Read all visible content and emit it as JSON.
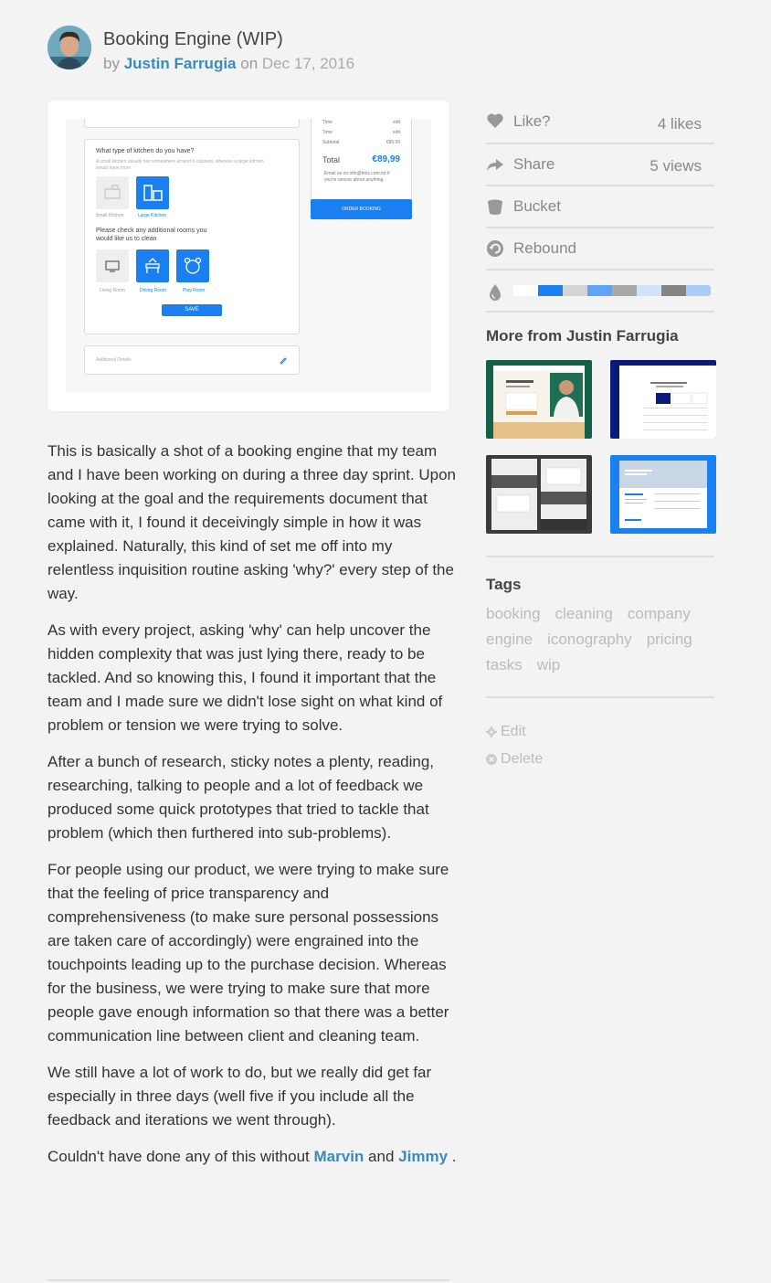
{
  "shot": {
    "title": "Booking Engine (WIP)",
    "by": "by",
    "author": "Justin Farrugia",
    "on": "on",
    "date": "Dec 17, 2016"
  },
  "preview": {
    "time1": "Time",
    "edit1": "edit",
    "time2": "Time",
    "edit2": "edit",
    "subtotal": "Subtotal",
    "subtotal_value": "€89.99",
    "total": "Total",
    "total_value": "€89,99",
    "email_line1": "Email us on info@briiz.com.mt if",
    "email_line2": "you're unsure about anything.",
    "order_button": "ORDER BOOKING",
    "kitchen_question": "What type of kitchen do you have?",
    "kitchen_hint1": "A small kitchen usually has somewhere around 6 cabinets, whereas a large kitchen",
    "kitchen_hint2": "would have more",
    "small_kitchen": "Small Kitchen",
    "large_kitchen": "Large Kitchen",
    "rooms_question1": "Please check any additional rooms you",
    "rooms_question2": "would like us to clean",
    "living_room": "Living Room",
    "dining_room": "Dining Room",
    "play_room": "Play Room",
    "save_button": "SAVE",
    "additional_details": "Additional Details"
  },
  "description": {
    "p1": "This is basically a shot of a booking engine that my team and I have been working on during a three day sprint. Upon looking at the goal and the requirements document that came with it, I found it deceivingly simple in how it was explained. Naturally, this kind of set me off into my relentless inquisition routine asking 'why?' every step of the way.",
    "p2": "As with every project, asking 'why' can help uncover the hidden complexity that was just lying there, ready to be tackled. And so knowing this, I found it important that the team and I made sure we didn't lose sight on what kind of problem or tension we were trying to solve.",
    "p3": "After a bunch of research, sticky notes a plenty, reading, researching, talking to people and a lot of feedback we produced some quick prototypes that tried to tackle that problem (which then furthered into sub-problems).",
    "p4": "For people using our product, we were trying to make sure that the feeling of price transparency and comprehensiveness (to make sure personal possessions are taken care of accordingly) were engrained into the touchpoints leading up to the purchase decision. Whereas for the business, we were trying to make sure that more people gave enough information so that there was a better communication line between client and cleaning team.",
    "p5": "We still have a lot of work to do, but we really did get far especially in three days (well five if you include all the feedback and iterations we went through).",
    "p6_prefix": "Couldn't have done any of this without",
    "p6_link1": "Marvin",
    "p6_and": "and",
    "p6_link2": "Jimmy",
    "p6_suffix": "."
  },
  "sidebar": {
    "like_label": "Like?",
    "likes_count": "4 likes",
    "share_label": "Share",
    "views_count": "5 views",
    "bucket_label": "Bucket",
    "rebound_label": "Rebound",
    "palette": [
      "#ffffff",
      "#1a7ff0",
      "#d5d5d5",
      "#5ea6f5",
      "#a8a8a8",
      "#cfe3fb",
      "#848484",
      "#a9cdf8"
    ],
    "more_title": "More from Justin Farrugia",
    "tags_title": "Tags",
    "tags": [
      "booking",
      "cleaning",
      "company",
      "engine",
      "iconography",
      "pricing",
      "tasks",
      "wip"
    ],
    "edit_label": "Edit",
    "delete_label": "Delete"
  },
  "colors": {
    "accent": "#3a8bbb",
    "brand_blue": "#1a7ff0",
    "background": "#f3f3f3"
  }
}
